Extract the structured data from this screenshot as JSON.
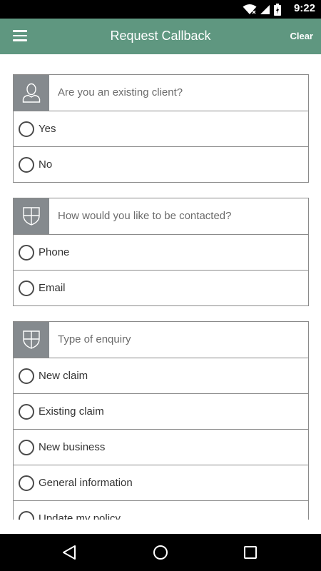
{
  "status_bar": {
    "time": "9:22",
    "icons": [
      "wifi-icon",
      "signal-icon",
      "battery-icon"
    ]
  },
  "app_bar": {
    "title": "Request Callback",
    "clear_label": "Clear",
    "menu_icon": "hamburger-menu-icon"
  },
  "colors": {
    "app_bar": "#5f9780",
    "icon_tile": "#858a8e",
    "border": "#8a8a8a"
  },
  "sections": [
    {
      "icon": "user-icon",
      "question": "Are you an existing client?",
      "options": [
        "Yes",
        "No"
      ]
    },
    {
      "icon": "shield-icon",
      "question": "How would you like to be contacted?",
      "options": [
        "Phone",
        "Email"
      ]
    },
    {
      "icon": "shield-icon",
      "question": "Type of enquiry",
      "options": [
        "New claim",
        "Existing claim",
        "New business",
        "General information",
        "Update my policy"
      ]
    }
  ],
  "nav_bar": {
    "buttons": [
      "back-icon",
      "home-icon",
      "recents-icon"
    ]
  }
}
